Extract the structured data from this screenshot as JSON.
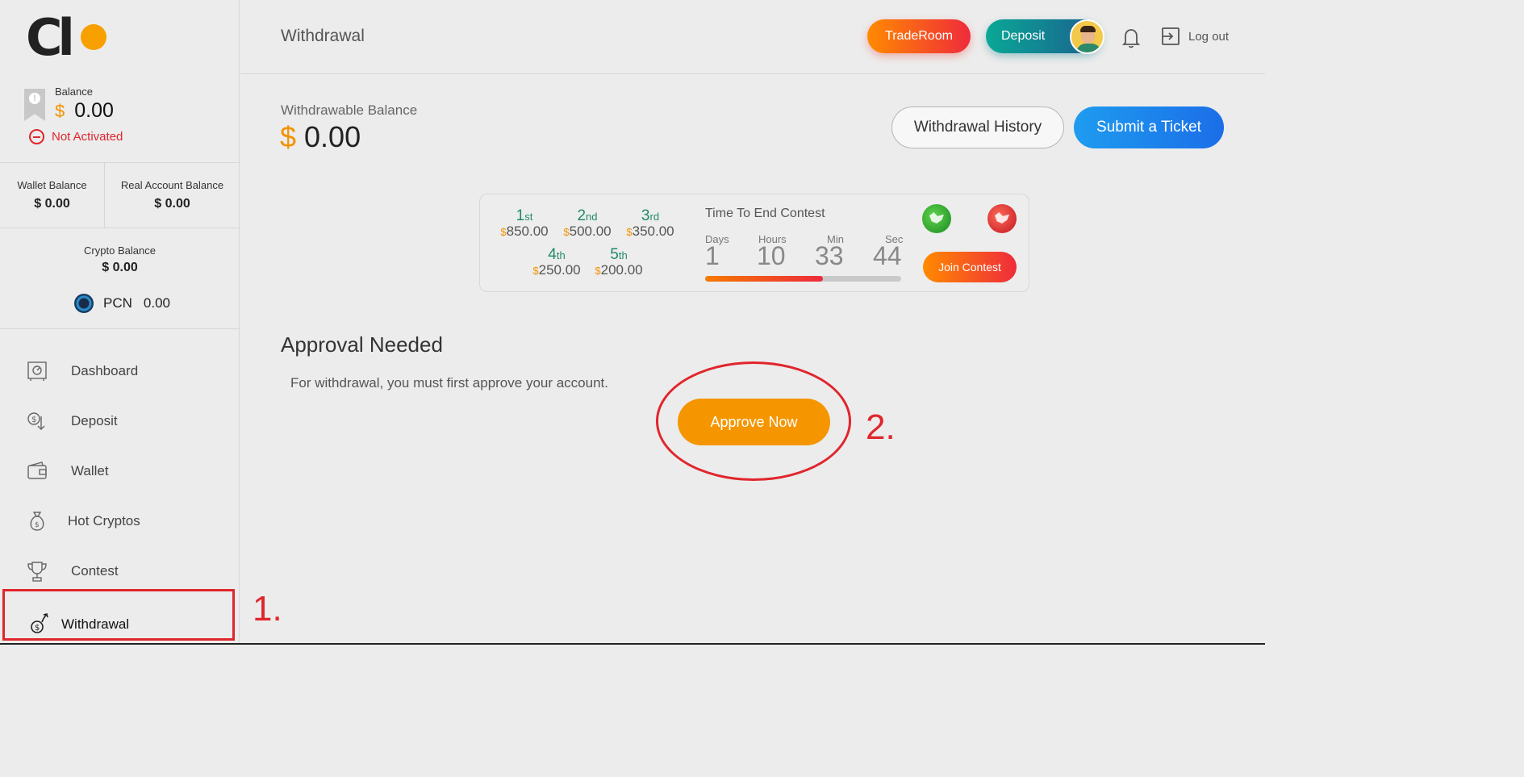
{
  "header": {
    "page_title": "Withdrawal",
    "traderoom_label": "TradeRoom",
    "deposit_label": "Deposit",
    "logout_label": "Log out"
  },
  "sidebar": {
    "balance_label": "Balance",
    "balance_currency": "$",
    "balance_value": "0.00",
    "status": "Not Activated",
    "wallet_balance_label": "Wallet Balance",
    "wallet_balance_value": "$ 0.00",
    "real_account_label": "Real Account Balance",
    "real_account_value": "$ 0.00",
    "crypto_balance_label": "Crypto Balance",
    "crypto_balance_value": "$ 0.00",
    "pcn_label": "PCN",
    "pcn_value": "0.00",
    "nav": [
      {
        "label": "Dashboard",
        "icon": "safe-icon"
      },
      {
        "label": "Deposit",
        "icon": "deposit-icon"
      },
      {
        "label": "Wallet",
        "icon": "wallet-icon"
      },
      {
        "label": "Hot Cryptos",
        "icon": "money-bag-icon"
      },
      {
        "label": "Contest",
        "icon": "trophy-icon"
      },
      {
        "label": "Withdrawal",
        "icon": "withdrawal-icon"
      }
    ]
  },
  "main": {
    "withdrawable_label": "Withdrawable Balance",
    "withdrawable_currency": "$",
    "withdrawable_value": "0.00",
    "history_button": "Withdrawal History",
    "ticket_button": "Submit a Ticket",
    "approval_title": "Approval Needed",
    "approval_text": "For withdrawal, you must first approve your account.",
    "approve_button": "Approve Now"
  },
  "contest": {
    "prizes": [
      {
        "num": "1",
        "suffix": "st",
        "currency": "$",
        "amount": "850.00"
      },
      {
        "num": "2",
        "suffix": "nd",
        "currency": "$",
        "amount": "500.00"
      },
      {
        "num": "3",
        "suffix": "rd",
        "currency": "$",
        "amount": "350.00"
      },
      {
        "num": "4",
        "suffix": "th",
        "currency": "$",
        "amount": "250.00"
      },
      {
        "num": "5",
        "suffix": "th",
        "currency": "$",
        "amount": "200.00"
      }
    ],
    "time_title": "Time To End Contest",
    "timer": [
      {
        "unit": "Days",
        "value": "1"
      },
      {
        "unit": "Hours",
        "value": "10"
      },
      {
        "unit": "Min",
        "value": "33"
      },
      {
        "unit": "Sec",
        "value": "44"
      }
    ],
    "progress_fraction": 0.6,
    "join_button": "Join Contest"
  },
  "annotations": {
    "step1": "1.",
    "step2": "2."
  },
  "colors": {
    "accent_orange": "#f39200",
    "alert_red": "#e0262c",
    "ticket_blue": "#1e8ef0",
    "deposit_teal": "#0aa896"
  }
}
